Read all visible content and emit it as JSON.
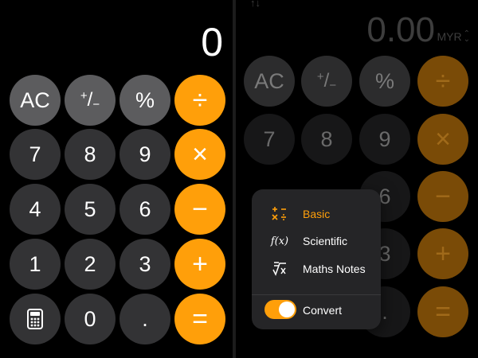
{
  "left": {
    "display": "0",
    "buttons": {
      "ac": "AC",
      "plus_minus_sup": "+",
      "plus_minus_slash": "/",
      "plus_minus_sub": "−",
      "percent": "%",
      "divide": "÷",
      "seven": "7",
      "eight": "8",
      "nine": "9",
      "multiply": "×",
      "four": "4",
      "five": "5",
      "six": "6",
      "minus": "−",
      "one": "1",
      "two": "2",
      "three": "3",
      "plus": "+",
      "zero": "0",
      "decimal": ".",
      "equals": "="
    }
  },
  "right": {
    "display": "0.00",
    "currency": "MYR",
    "buttons": {
      "ac": "AC",
      "plus_minus_sup": "+",
      "plus_minus_slash": "/",
      "plus_minus_sub": "−",
      "percent": "%",
      "divide": "÷",
      "seven": "7",
      "eight": "8",
      "nine": "9",
      "multiply": "×",
      "six": "6",
      "minus": "−",
      "three": "3",
      "plus": "+",
      "decimal": ".",
      "equals": "="
    },
    "menu": {
      "items": [
        {
          "icon": "basic-ops-icon",
          "label": "Basic",
          "selected": true
        },
        {
          "icon": "function-icon",
          "label": "Scientific",
          "selected": false
        },
        {
          "icon": "maths-notes-icon",
          "label": "Maths Notes",
          "selected": false
        }
      ],
      "convert_label": "Convert",
      "convert_on": true
    }
  },
  "colors": {
    "operator": "#ff9f0a",
    "function_key": "#5c5c5e",
    "number_key": "#333335",
    "background": "#000000"
  }
}
